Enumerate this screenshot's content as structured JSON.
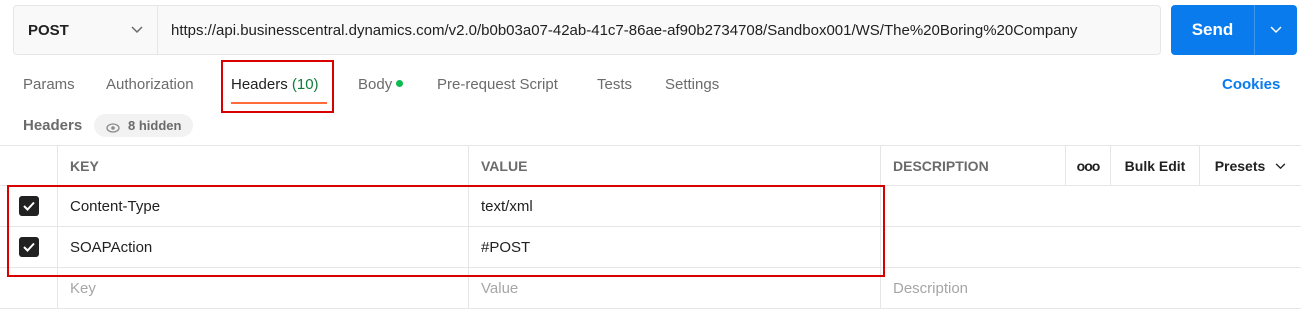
{
  "request": {
    "method": "POST",
    "url": "https://api.businesscentral.dynamics.com/v2.0/b0b03a07-42ab-41c7-86ae-af90b2734708/Sandbox001/WS/The%20Boring%20Company",
    "send_label": "Send"
  },
  "tabs": [
    {
      "label": "Params"
    },
    {
      "label": "Authorization"
    },
    {
      "label": "Headers",
      "count": "(10)"
    },
    {
      "label": "Body"
    },
    {
      "label": "Pre-request Script"
    },
    {
      "label": "Tests"
    },
    {
      "label": "Settings"
    }
  ],
  "cookies_label": "Cookies",
  "headers_section": {
    "label": "Headers",
    "hidden_label": "8 hidden"
  },
  "table": {
    "columns": {
      "key": "KEY",
      "value": "VALUE",
      "description": "DESCRIPTION"
    },
    "more_label": "ooo",
    "bulk_edit_label": "Bulk Edit",
    "presets_label": "Presets",
    "rows": [
      {
        "checked": true,
        "key": "Content-Type",
        "value": "text/xml",
        "description": ""
      },
      {
        "checked": true,
        "key": "SOAPAction",
        "value": "#POST",
        "description": ""
      }
    ],
    "placeholders": {
      "key": "Key",
      "value": "Value",
      "description": "Description"
    }
  },
  "colors": {
    "accent": "#097bed",
    "active_tab_underline": "#ff6c37",
    "count_green": "#0f7e3b",
    "body_dot": "#0cbb52",
    "highlight_red": "#d90000"
  }
}
